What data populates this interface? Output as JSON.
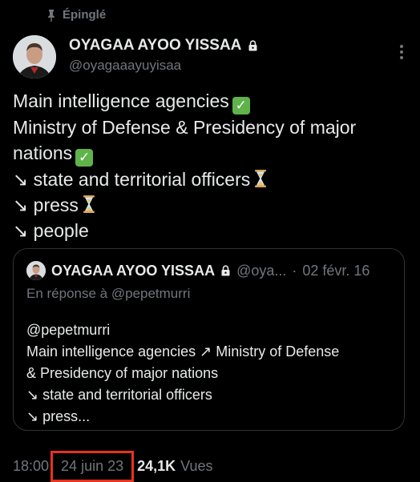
{
  "pinned": {
    "label": "Épinglé",
    "icon": "pin-icon"
  },
  "author": {
    "name": "OYAGAA AYOO YISSAA",
    "handle": "@oyagaaayuyisaa",
    "lock_icon": "lock-icon",
    "avatar_icon": "avatar"
  },
  "menu": {
    "icon": "more-vertical-icon"
  },
  "tweet": {
    "lines": [
      {
        "text": "Main intelligence agencies",
        "emoji": "check"
      },
      {
        "text": "Ministry of Defense & Presidency of major",
        "emoji": ""
      },
      {
        "text": "nations",
        "emoji": "check"
      },
      {
        "text": "↘ state and territorial officers",
        "emoji": "hourglass"
      },
      {
        "text": "↘ press",
        "emoji": "hourglass"
      },
      {
        "text": "↘ people",
        "emoji": ""
      }
    ]
  },
  "quote": {
    "name": "OYAGAA AYOO YISSAA",
    "handle": "@oya...",
    "separator": "·",
    "date": "02 févr. 16",
    "reply_to": "En réponse à @pepetmurri",
    "lines": [
      "@pepetmurri",
      "Main intelligence agencies ↗ Ministry of Defense",
      "& Presidency of major nations",
      "↘ state and territorial officers",
      "↘ press..."
    ]
  },
  "meta": {
    "time": "18:00",
    "date": "24 juin 23",
    "views_count": "24,1K",
    "views_label": "Vues",
    "highlight_color": "#e8321e"
  },
  "colors": {
    "background": "#000000",
    "text": "#e7e9ea",
    "secondary": "#71767b",
    "border": "#2f3336"
  }
}
